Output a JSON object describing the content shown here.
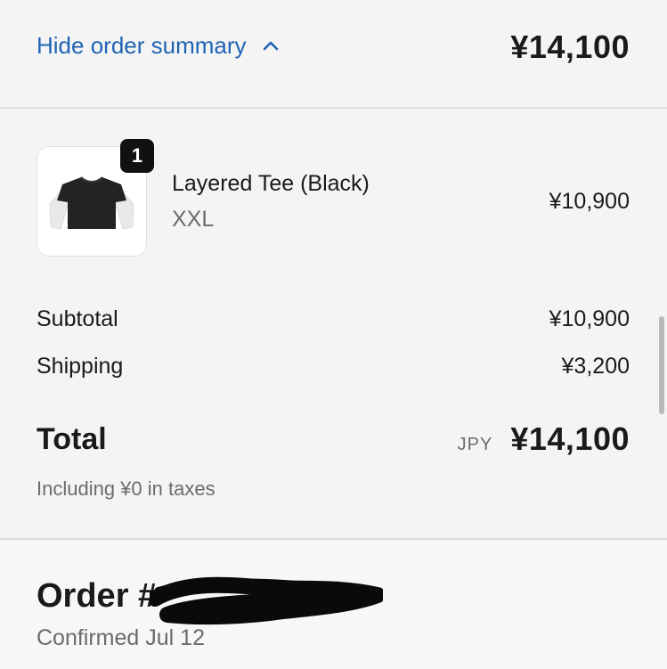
{
  "header": {
    "toggle_label": "Hide order summary",
    "total": "¥14,100",
    "accent_color": "#1f64b4"
  },
  "product": {
    "quantity": "1",
    "name": "Layered Tee (Black)",
    "variant": "XXL",
    "price": "¥10,900"
  },
  "summary": {
    "subtotal_label": "Subtotal",
    "subtotal_value": "¥10,900",
    "shipping_label": "Shipping",
    "shipping_value": "¥3,200",
    "total_label": "Total",
    "currency": "JPY",
    "total_value": "¥14,100",
    "taxes_note": "Including ¥0 in taxes"
  },
  "order": {
    "title": "Order #",
    "confirmed": "Confirmed Jul 12"
  }
}
